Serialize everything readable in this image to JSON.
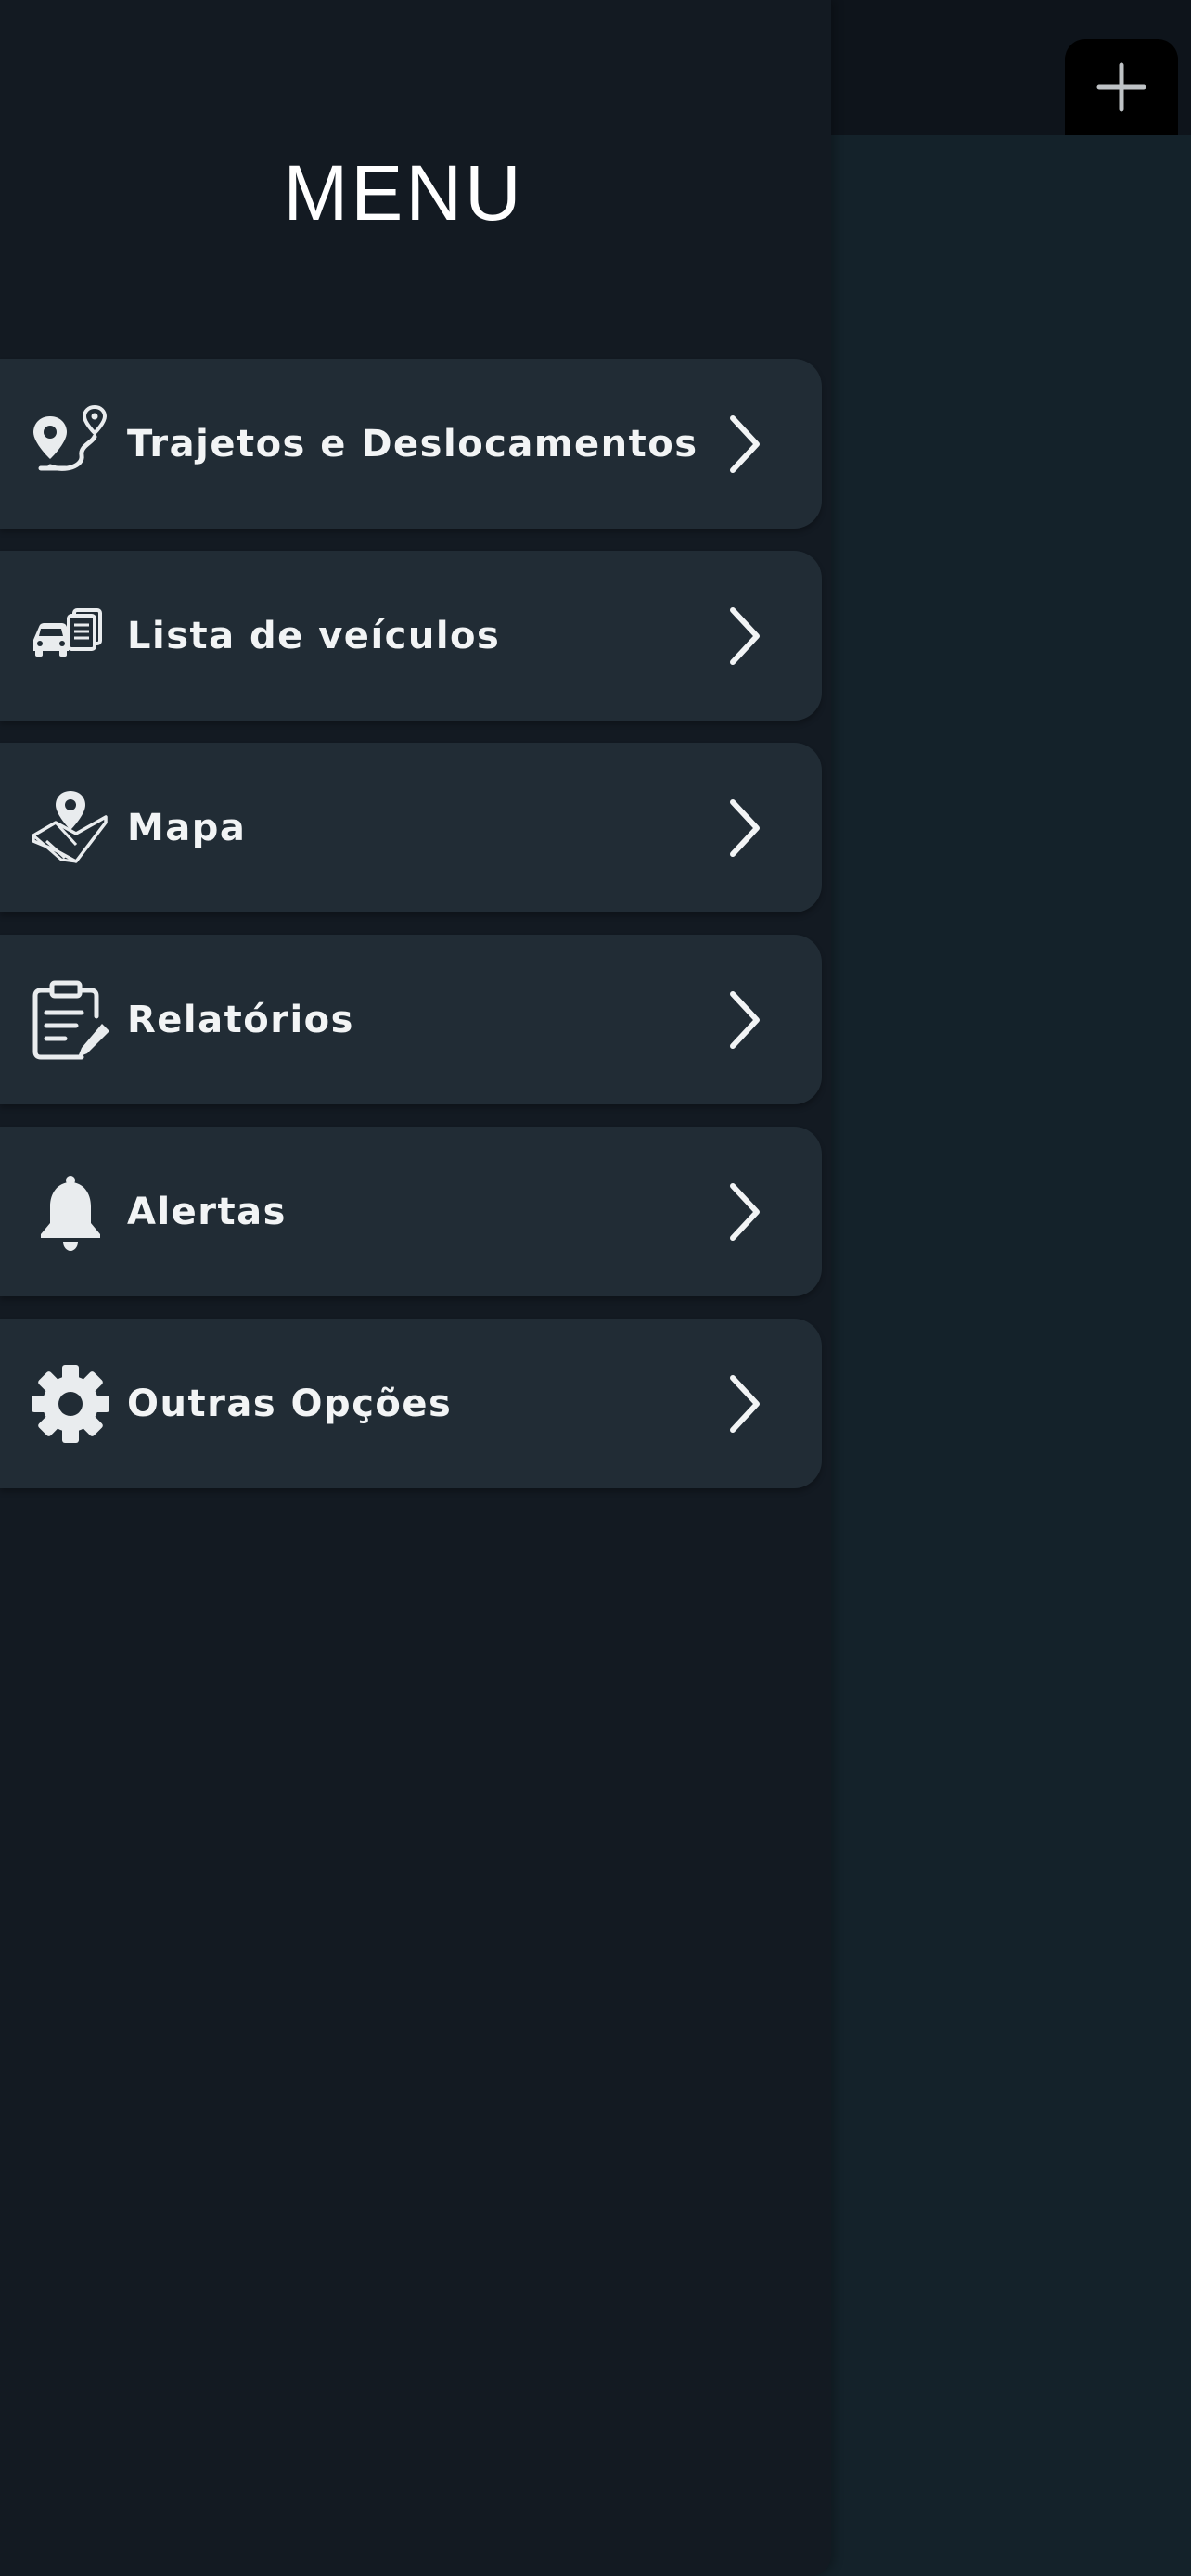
{
  "header": {
    "add_button_icon": "plus-icon"
  },
  "drawer": {
    "title": "MENU",
    "items": [
      {
        "label": "Trajetos e Deslocamentos",
        "icon": "route-pin-icon"
      },
      {
        "label": "Lista de veículos",
        "icon": "vehicle-list-icon"
      },
      {
        "label": "Mapa",
        "icon": "map-pin-icon"
      },
      {
        "label": "Relatórios",
        "icon": "report-clipboard-icon"
      },
      {
        "label": "Alertas",
        "icon": "bell-icon"
      },
      {
        "label": "Outras Opções",
        "icon": "gear-icon"
      }
    ]
  },
  "colors": {
    "drawer_bg": "#131a22",
    "item_bg": "#212c35",
    "main_bg": "#14222a",
    "text": "#f2f4f5"
  }
}
